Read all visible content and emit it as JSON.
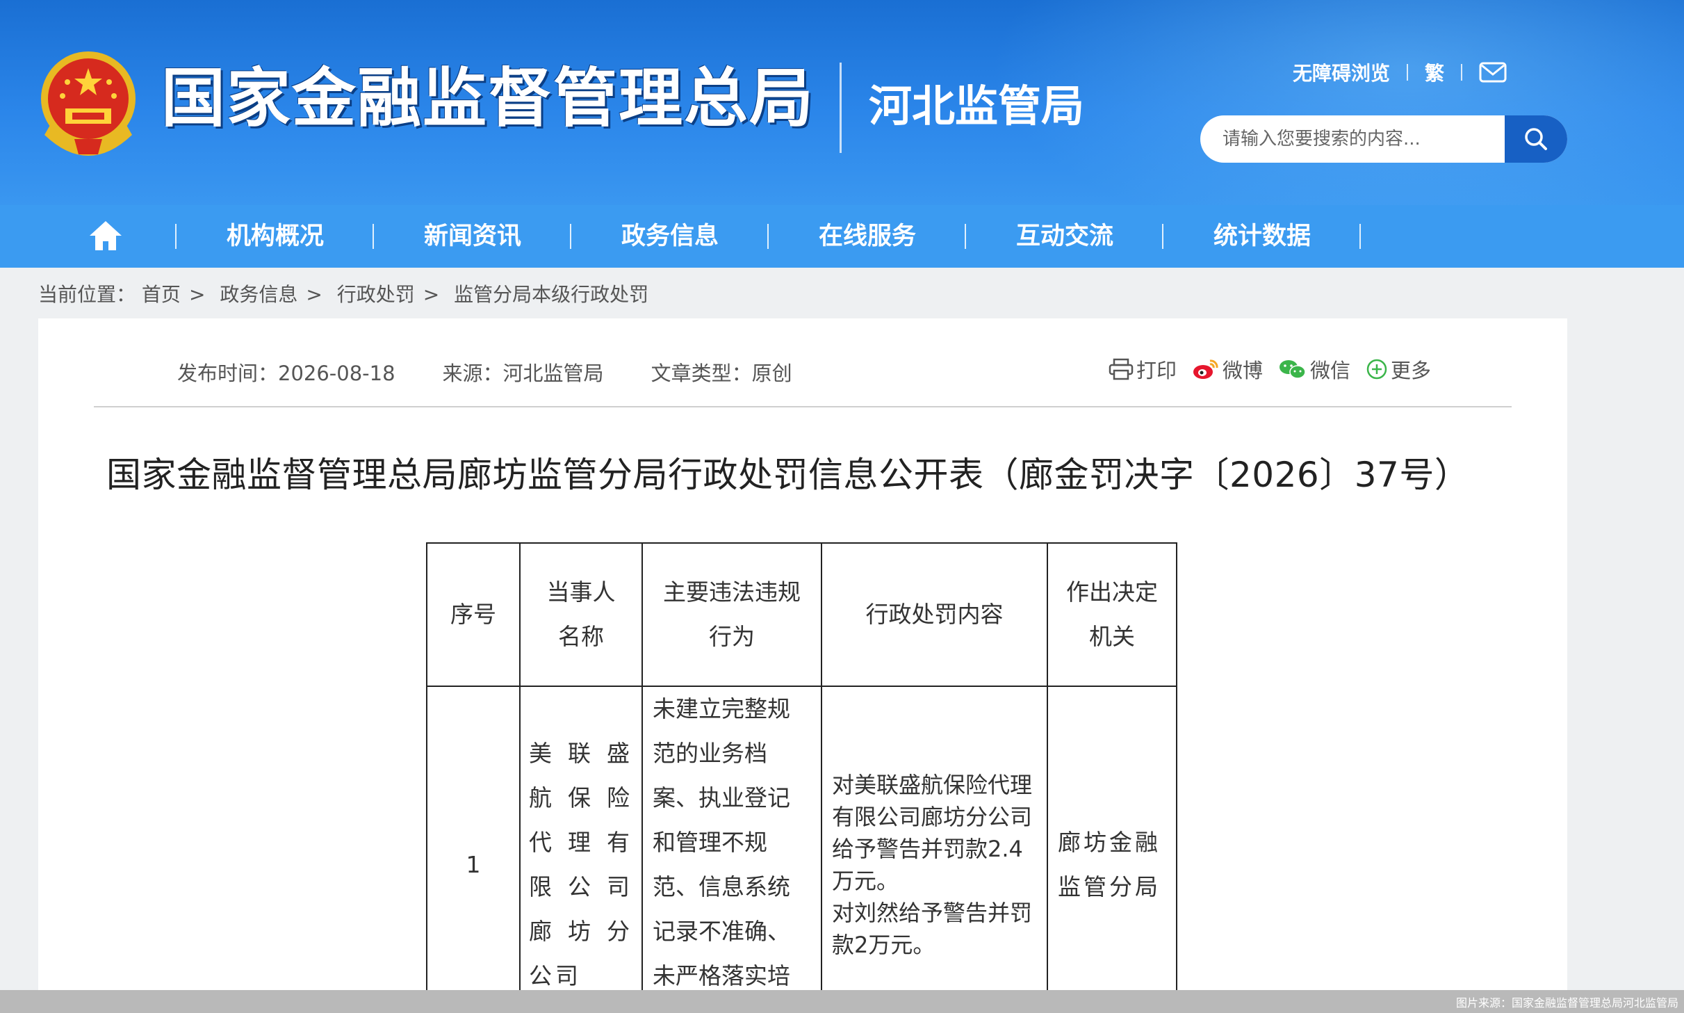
{
  "header": {
    "site_title": "国家金融监督管理总局",
    "sub_title": "河北监管局",
    "top_links": {
      "accessibility": "无障碍浏览",
      "traditional": "繁"
    },
    "search": {
      "placeholder": "请输入您要搜索的内容..."
    },
    "emblem_icon": "national-emblem-icon",
    "colors": {
      "header_blue": "#2b86ea",
      "nav_blue": "#3b9bf1",
      "search_button": "#1760c4"
    }
  },
  "nav": {
    "items": [
      {
        "label": "机构概况"
      },
      {
        "label": "新闻资讯"
      },
      {
        "label": "政务信息"
      },
      {
        "label": "在线服务"
      },
      {
        "label": "互动交流"
      },
      {
        "label": "统计数据"
      }
    ]
  },
  "breadcrumb": {
    "prefix": "当前位置：",
    "items": [
      "首页",
      "政务信息",
      "行政处罚",
      "监管分局本级行政处罚"
    ]
  },
  "article": {
    "publish_time": "发布时间：2026-08-18",
    "source": "来源：河北监管局",
    "type": "文章类型：原创",
    "share": {
      "print": "打印",
      "weibo": "微博",
      "wechat": "微信",
      "more": "更多"
    },
    "title": "国家金融监督管理总局廊坊监管分局行政处罚信息公开表（廊金罚决字〔2026〕37号）"
  },
  "table": {
    "headers": {
      "num": "序号",
      "party_1": "当事人",
      "party_2": "名称",
      "violation_1": "主要违法违规",
      "violation_2": "行为",
      "penalty": "行政处罚内容",
      "authority_1": "作出决定",
      "authority_2": "机关"
    },
    "row": {
      "num": "1",
      "party": "美联盛航保险代理有限公司廊坊分公司",
      "violation": "未建立完整规范的业务档案、执业登记和管理不规范、信息系统记录不准确、未严格落实培训管理要求",
      "penalty_1": "对美联盛航保险代理有限公司廊坊分公司给予警告并罚款2.4万元。",
      "penalty_2": "对刘然给予警告并罚款2万元。",
      "authority": "廊坊金融监管分局"
    }
  },
  "footer": {
    "credit": "图片来源：国家金融监督管理总局河北监管局"
  }
}
